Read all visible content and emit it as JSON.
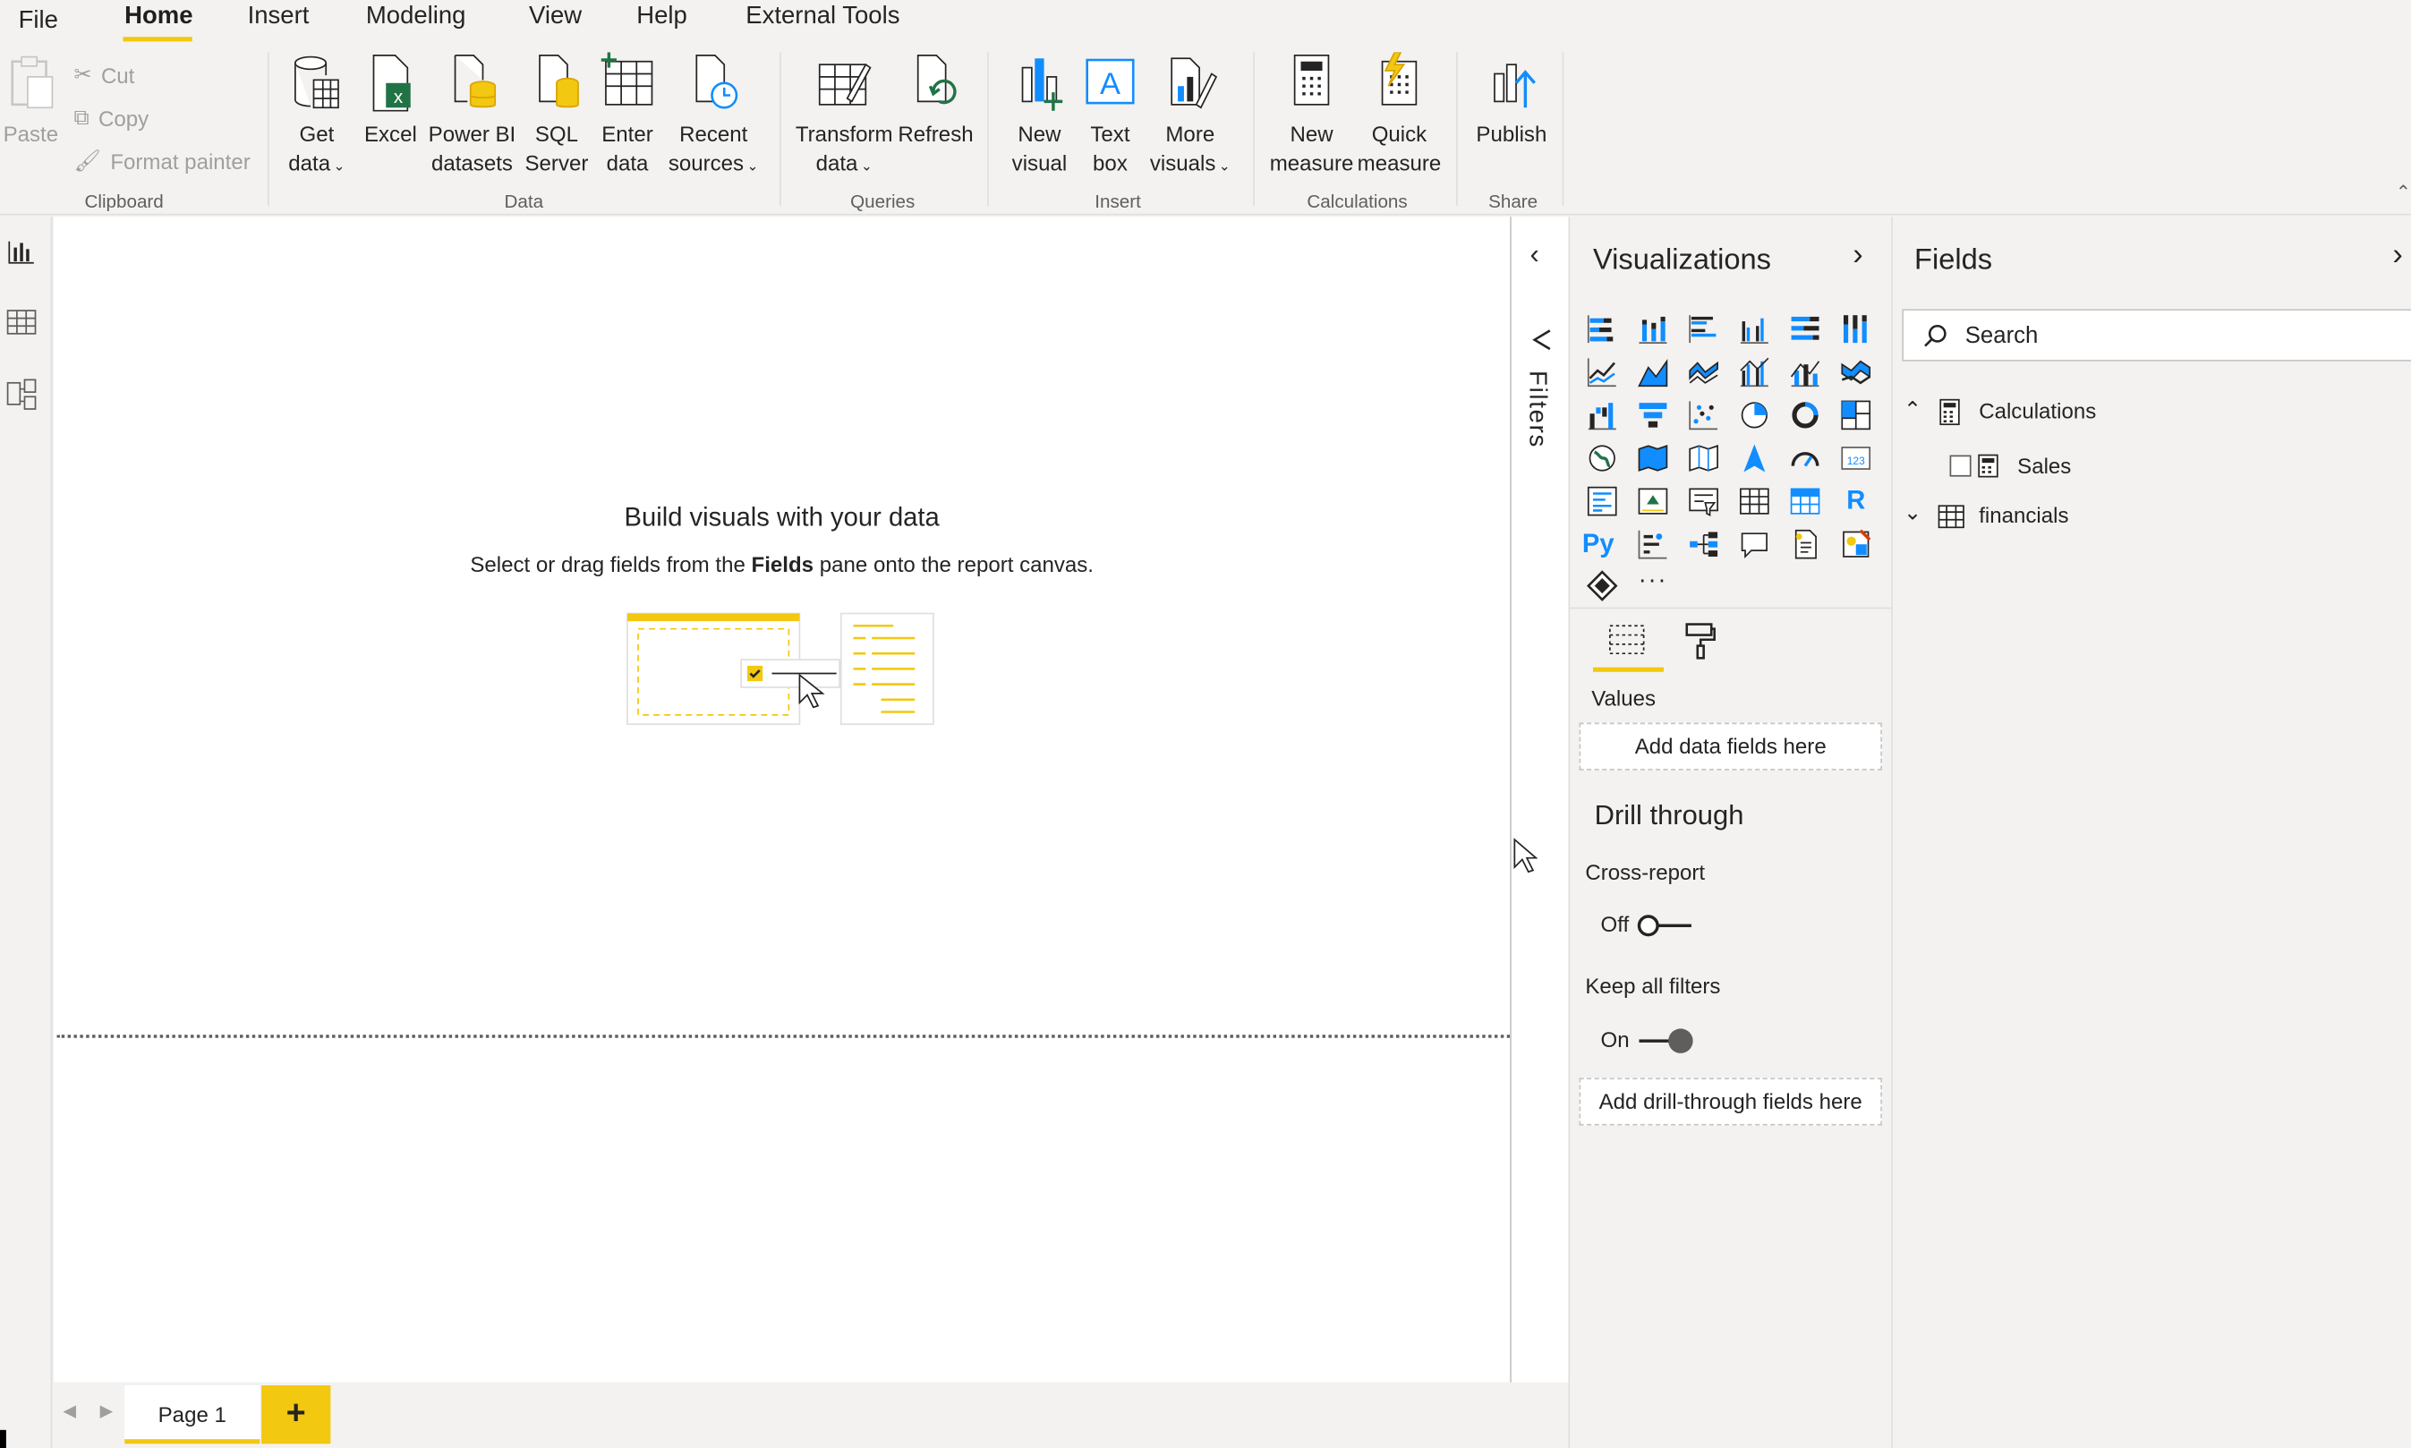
{
  "menu": {
    "file": "File",
    "home": "Home",
    "insert": "Insert",
    "modeling": "Modeling",
    "view": "View",
    "help": "Help",
    "external_tools": "External Tools"
  },
  "ribbon": {
    "clipboard": {
      "paste": "Paste",
      "cut": "Cut",
      "copy": "Copy",
      "format_painter": "Format painter",
      "group": "Clipboard"
    },
    "data": {
      "get_data_1": "Get",
      "get_data_2": "data",
      "excel": "Excel",
      "powerbi_1": "Power BI",
      "powerbi_2": "datasets",
      "sql_1": "SQL",
      "sql_2": "Server",
      "enter_1": "Enter",
      "enter_2": "data",
      "recent_1": "Recent",
      "recent_2": "sources",
      "group": "Data"
    },
    "queries": {
      "transform_1": "Transform",
      "transform_2": "data",
      "refresh": "Refresh",
      "group": "Queries"
    },
    "insert": {
      "new_visual_1": "New",
      "new_visual_2": "visual",
      "text_box_1": "Text",
      "text_box_2": "box",
      "more_visuals_1": "More",
      "more_visuals_2": "visuals",
      "group": "Insert"
    },
    "calculations": {
      "new_measure_1": "New",
      "new_measure_2": "measure",
      "quick_measure_1": "Quick",
      "quick_measure_2": "measure",
      "group": "Calculations"
    },
    "share": {
      "publish": "Publish",
      "group": "Share"
    }
  },
  "canvas": {
    "title": "Build visuals with your data",
    "subtitle_pre": "Select or drag fields from the ",
    "subtitle_bold": "Fields",
    "subtitle_post": " pane onto the report canvas."
  },
  "pages": {
    "tab": "Page 1",
    "add": "+"
  },
  "filters": {
    "label": "Filters"
  },
  "visualizations": {
    "title": "Visualizations",
    "values_label": "Values",
    "values_placeholder": "Add data fields here",
    "drill_through": "Drill through",
    "cross_report": "Cross-report",
    "cross_report_state": "Off",
    "keep_all_filters": "Keep all filters",
    "keep_all_filters_state": "On",
    "drill_placeholder": "Add drill-through fields here",
    "r_icon_text": "R",
    "py_icon_text": "Py",
    "more_icon_text": "···"
  },
  "fields": {
    "title": "Fields",
    "search_placeholder": "Search",
    "tables": [
      {
        "name": "Calculations",
        "expanded": true,
        "children": [
          "Sales"
        ]
      },
      {
        "name": "financials",
        "expanded": false
      }
    ]
  },
  "colors": {
    "accent": "#f2c811",
    "excel_green": "#217346",
    "icon_blue": "#118dff",
    "background": "#f3f2f1"
  }
}
